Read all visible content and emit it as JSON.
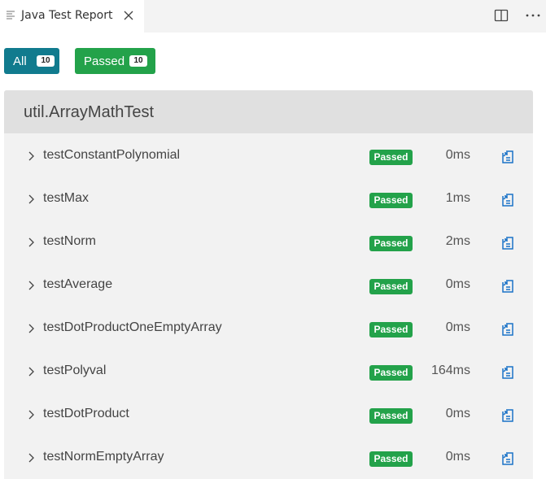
{
  "tab": {
    "title": "Java Test Report",
    "icon": "report-lines-icon",
    "close_icon": "close-icon"
  },
  "toolbar": {
    "split_icon": "split-editor-icon",
    "more_icon": "more-actions-icon"
  },
  "filters": [
    {
      "label": "All",
      "count": "10",
      "color": "#117b8e"
    },
    {
      "label": "Passed",
      "count": "10",
      "color": "#23a24a"
    }
  ],
  "suite": {
    "name": "util.ArrayMathTest",
    "tests": [
      {
        "name": "testConstantPolynomial",
        "status": "Passed",
        "duration": "0ms"
      },
      {
        "name": "testMax",
        "status": "Passed",
        "duration": "1ms"
      },
      {
        "name": "testNorm",
        "status": "Passed",
        "duration": "2ms"
      },
      {
        "name": "testAverage",
        "status": "Passed",
        "duration": "0ms"
      },
      {
        "name": "testDotProductOneEmptyArray",
        "status": "Passed",
        "duration": "0ms"
      },
      {
        "name": "testPolyval",
        "status": "Passed",
        "duration": "164ms"
      },
      {
        "name": "testDotProduct",
        "status": "Passed",
        "duration": "0ms"
      },
      {
        "name": "testNormEmptyArray",
        "status": "Passed",
        "duration": "0ms"
      }
    ]
  },
  "colors": {
    "passed": "#23a24a",
    "link": "#1a73c8"
  }
}
